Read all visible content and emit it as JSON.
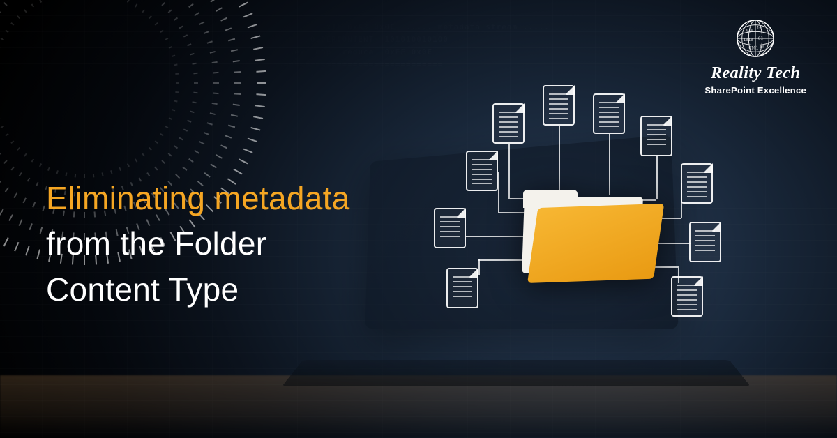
{
  "brand": {
    "name": "Reality Tech",
    "tagline": "SharePoint Excellence"
  },
  "heading": {
    "line1": "Eliminating metadata",
    "line2": "from the Folder",
    "line3": "Content Type"
  },
  "colors": {
    "accent": "#f5a623",
    "text": "#ffffff"
  },
  "icons": {
    "folder": "folder-icon",
    "document": "document-icon",
    "globe": "globe-icon"
  }
}
